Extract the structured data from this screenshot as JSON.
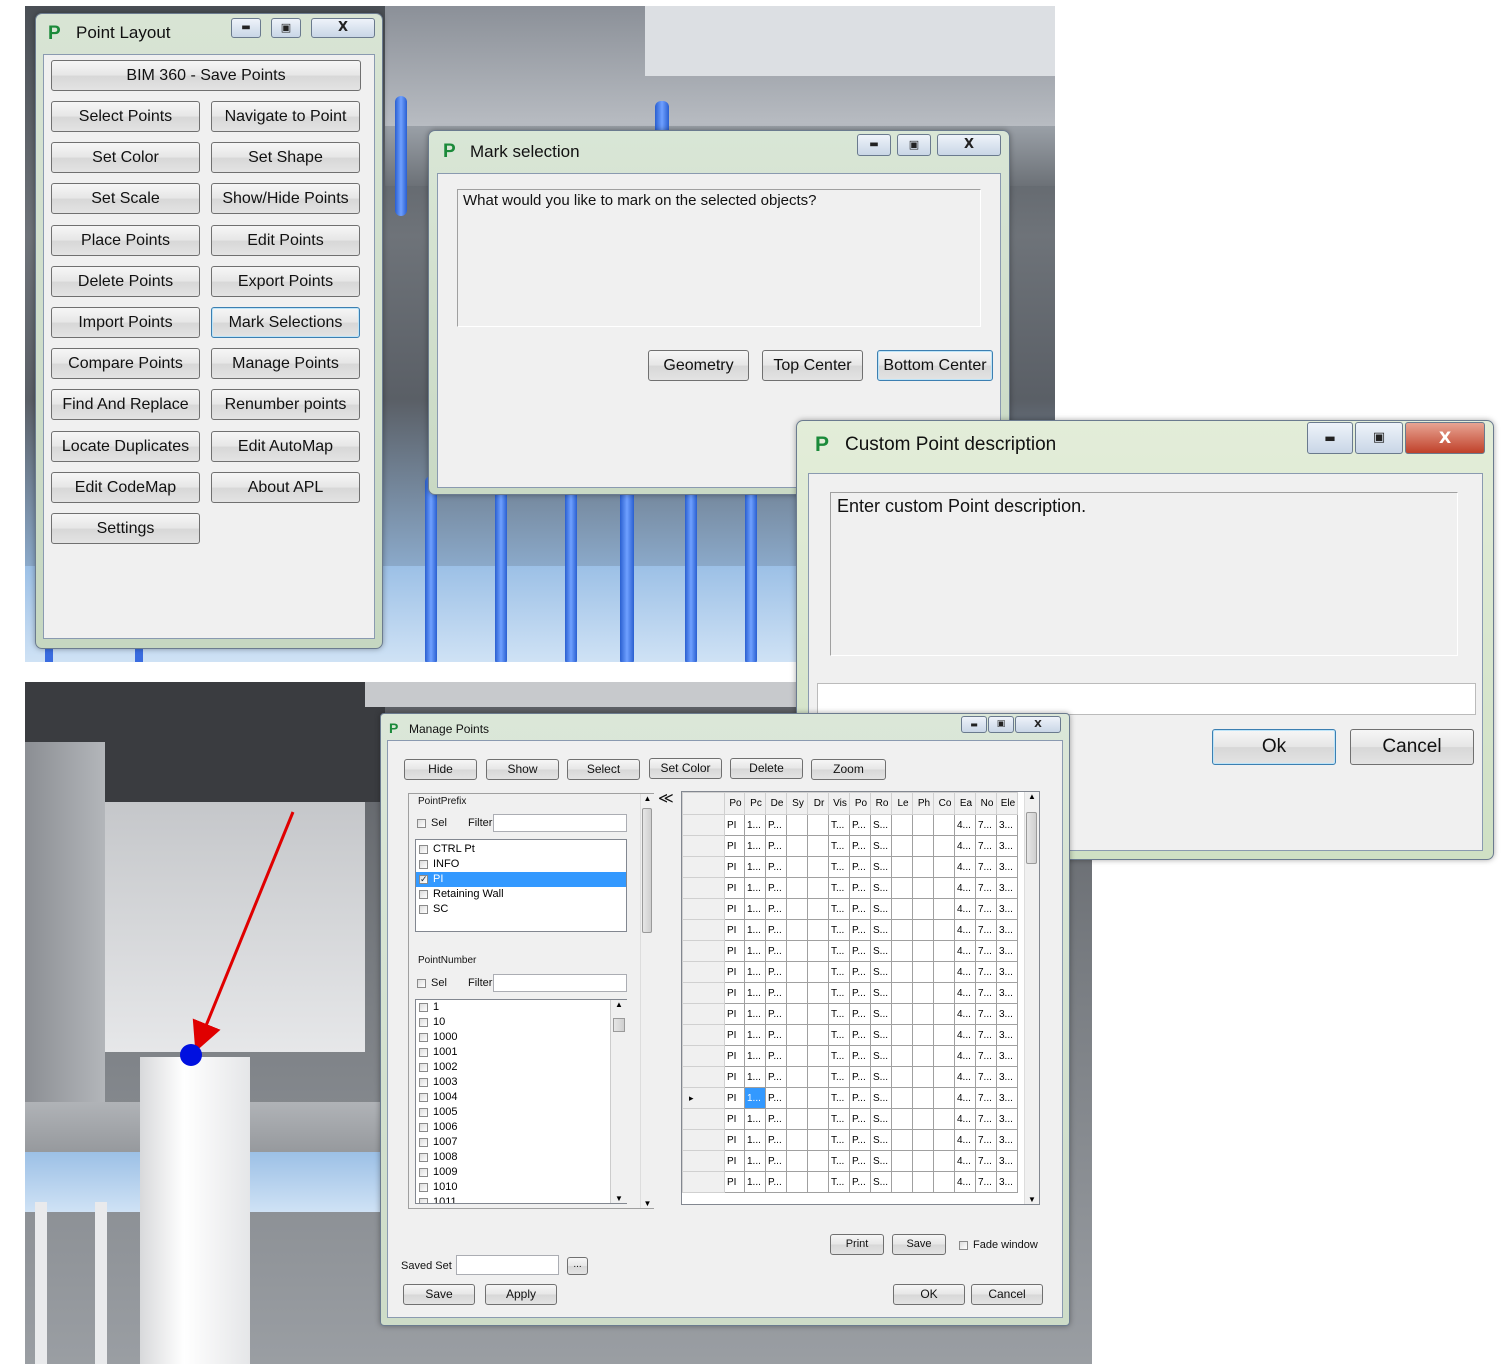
{
  "point_layout": {
    "title": "Point Layout",
    "logo": "P",
    "window_buttons": {
      "minimize": "▬",
      "maximize": "▣",
      "close": "X"
    },
    "bim_button": "BIM 360 - Save Points",
    "buttons": [
      "Select Points",
      "Navigate to Point",
      "Set Color",
      "Set Shape",
      "Set Scale",
      "Show/Hide Points",
      "Place Points",
      "Edit Points",
      "Delete Points",
      "Export Points",
      "Import Points",
      "Mark Selections",
      "Compare Points",
      "Manage  Points",
      "Find And Replace",
      "Renumber points",
      "Locate Duplicates",
      "Edit AutoMap",
      "Edit CodeMap",
      "About APL",
      "Settings"
    ]
  },
  "mark_selection": {
    "title": "Mark selection",
    "logo": "P",
    "prompt": "What would you like to mark on the selected objects?",
    "buttons": {
      "geometry": "Geometry",
      "top_center": "Top Center",
      "bottom_center": "Bottom Center"
    }
  },
  "custom_point": {
    "title": "Custom Point description",
    "logo": "P",
    "prompt": "Enter custom Point description.",
    "input_value": "",
    "ok": "Ok",
    "cancel": "Cancel"
  },
  "manage_points": {
    "title": "Manage Points",
    "logo": "P",
    "toolbar": {
      "hide": "Hide",
      "show": "Show",
      "select": "Select",
      "set_color": "Set Color",
      "delete": "Delete",
      "zoom": "Zoom"
    },
    "collapse_glyph": "≪",
    "prefix_panel": {
      "label": "PointPrefix",
      "sel": "Sel",
      "filter": "Filter",
      "items": [
        {
          "label": "CTRL Pt",
          "checked": false
        },
        {
          "label": "INFO",
          "checked": false
        },
        {
          "label": "PI",
          "checked": true
        },
        {
          "label": "Retaining Wall",
          "checked": false
        },
        {
          "label": "SC",
          "checked": false
        }
      ]
    },
    "number_panel": {
      "label": "PointNumber",
      "sel": "Sel",
      "filter": "Filter",
      "items": [
        "1",
        "10",
        "1000",
        "1001",
        "1002",
        "1003",
        "1004",
        "1005",
        "1006",
        "1007",
        "1008",
        "1009",
        "1010",
        "1011"
      ]
    },
    "grid": {
      "columns": [
        "Po",
        "Pc",
        "De",
        "Sy",
        "Dr",
        "Vis",
        "Po",
        "Ro",
        "Le",
        "Ph",
        "Co",
        "Ea",
        "No",
        "Ele"
      ],
      "row_template": [
        "PI",
        "1...",
        "P...",
        "",
        "",
        "T...",
        "P...",
        "S...",
        "",
        "",
        "",
        "4...",
        "7...",
        "3..."
      ],
      "row_count": 18,
      "current_row": 13
    },
    "print": "Print",
    "save_grid": "Save",
    "fade_window": "Fade window",
    "saved_set_label": "Saved Set",
    "saved_set_value": "",
    "browse": "...",
    "save": "Save",
    "apply": "Apply",
    "ok": "OK",
    "cancel": "Cancel"
  }
}
